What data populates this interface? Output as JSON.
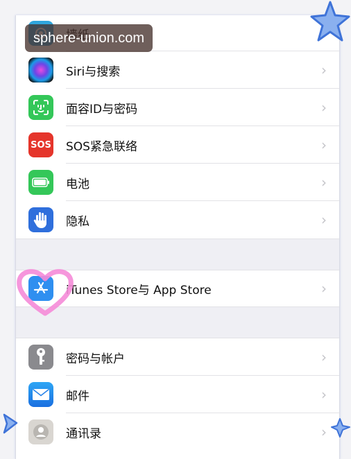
{
  "watermark": "sphere-union.com",
  "settings": {
    "group1": [
      {
        "label": "墙纸",
        "icon": "wallpaper-icon",
        "color": "#30a6dd"
      },
      {
        "label": "Siri与搜索",
        "icon": "siri-icon",
        "color": "#1b1b2e"
      },
      {
        "label": "面容ID与密码",
        "icon": "face-id-icon",
        "color": "#34c759"
      },
      {
        "label": "SOS紧急联络",
        "icon": "sos-icon",
        "color": "#e5352b",
        "icon_text": "SOS"
      },
      {
        "label": "电池",
        "icon": "battery-icon",
        "color": "#34c759"
      },
      {
        "label": "隐私",
        "icon": "privacy-hand-icon",
        "color": "#2f6fdc"
      }
    ],
    "group2": [
      {
        "label": "iTunes Store与 App Store",
        "icon": "app-store-icon",
        "color": "#2f8ff0"
      }
    ],
    "group3": [
      {
        "label": "密码与帐户",
        "icon": "key-icon",
        "color": "#8a8a8e"
      },
      {
        "label": "邮件",
        "icon": "mail-icon",
        "color": "#2f8ff0"
      },
      {
        "label": "通讯录",
        "icon": "contacts-icon",
        "color": "#c8c6c2"
      }
    ],
    "chevron": "›"
  }
}
